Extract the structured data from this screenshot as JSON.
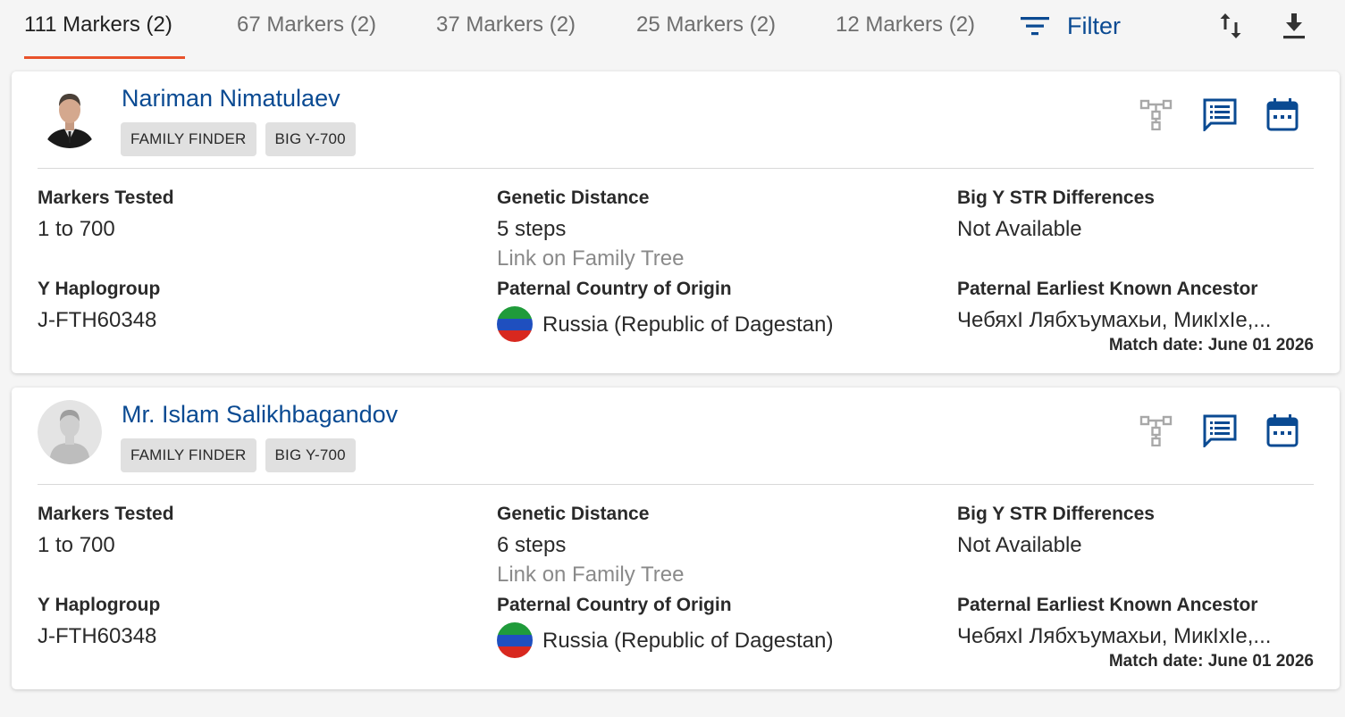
{
  "tabs": [
    {
      "label": "111 Markers (2)",
      "active": true
    },
    {
      "label": "67 Markers (2)",
      "active": false
    },
    {
      "label": "37 Markers (2)",
      "active": false
    },
    {
      "label": "25 Markers (2)",
      "active": false
    },
    {
      "label": "12 Markers (2)",
      "active": false
    }
  ],
  "toolbar": {
    "filter_label": "Filter",
    "sort_icon": "sort-icon",
    "download_icon": "download-icon"
  },
  "colors": {
    "accent": "#0a4a92",
    "active_tab_underline": "#e8522b",
    "badge_bg": "#e0e0e0"
  },
  "labels": {
    "markers_tested": "Markers Tested",
    "genetic_distance": "Genetic Distance",
    "big_y_str": "Big Y STR Differences",
    "y_haplogroup": "Y Haplogroup",
    "paternal_country": "Paternal Country of Origin",
    "paternal_ancestor": "Paternal Earliest Known Ancestor",
    "link_family_tree": "Link on Family Tree"
  },
  "matches": [
    {
      "name": "Nariman Nimatulaev",
      "avatar": "photo",
      "badges": [
        "FAMILY FINDER",
        "BIG Y-700"
      ],
      "markers_tested": "1 to 700",
      "genetic_distance": "5 steps",
      "big_y_str": "Not Available",
      "y_haplogroup": "J-FTH60348",
      "country": "Russia (Republic of Dagestan)",
      "ancestor": "ЧебяхI Лябхъумахьи, МикIхIе,...",
      "match_date": "Match date: June 01 2026"
    },
    {
      "name": "Mr. Islam Salikhbagandov",
      "avatar": "placeholder",
      "badges": [
        "FAMILY FINDER",
        "BIG Y-700"
      ],
      "markers_tested": "1 to 700",
      "genetic_distance": "6 steps",
      "big_y_str": "Not Available",
      "y_haplogroup": "J-FTH60348",
      "country": "Russia (Republic of Dagestan)",
      "ancestor": "ЧебяхI Лябхъумахьи, МикIхIе,...",
      "match_date": "Match date: June 01 2026"
    }
  ]
}
